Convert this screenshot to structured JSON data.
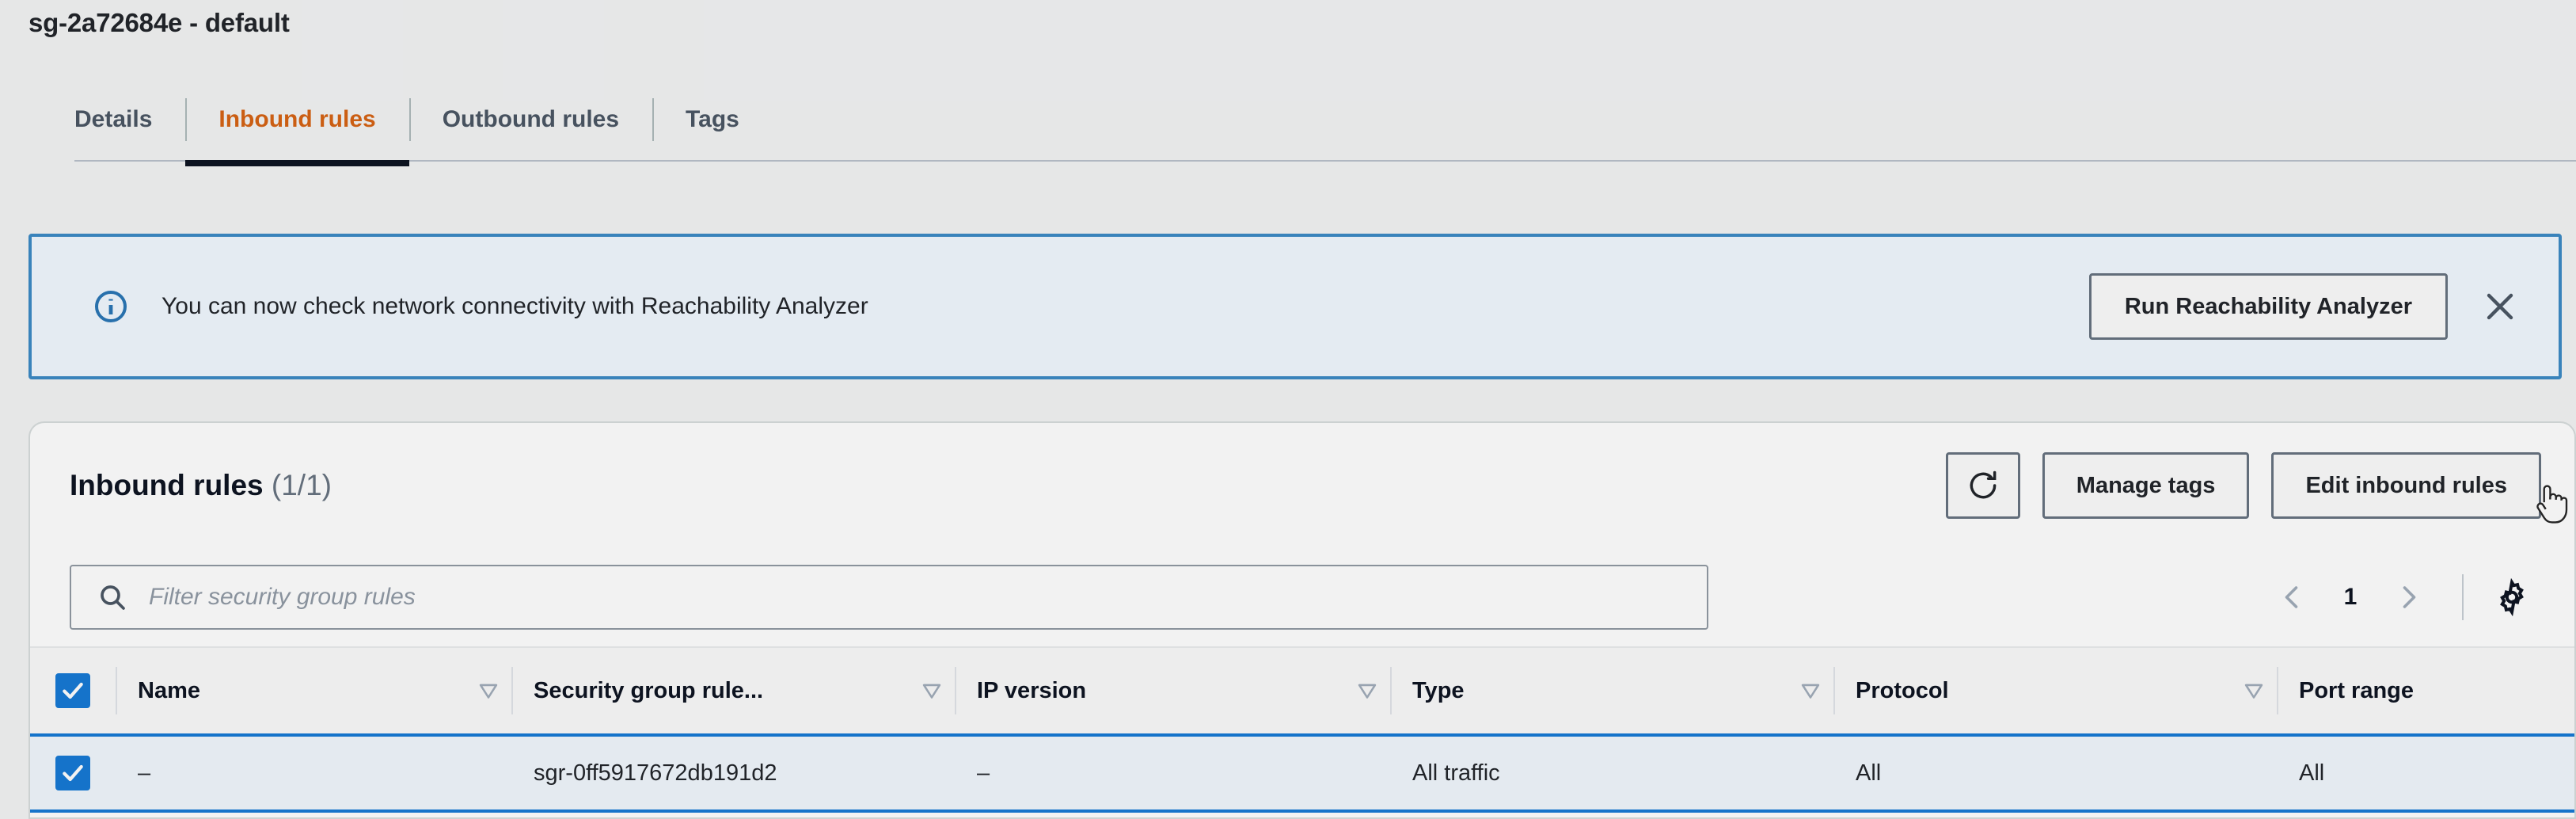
{
  "header": {
    "title": "sg-2a72684e - default"
  },
  "tabs": [
    {
      "label": "Details",
      "active": false
    },
    {
      "label": "Inbound rules",
      "active": true
    },
    {
      "label": "Outbound rules",
      "active": false
    },
    {
      "label": "Tags",
      "active": false
    }
  ],
  "flashbar": {
    "icon": "info-icon",
    "message": "You can now check network connectivity with Reachability Analyzer",
    "action_label": "Run Reachability Analyzer",
    "close_icon": "close-icon",
    "accent_color": "#3184c2",
    "background_color": "#f0f8ff"
  },
  "panel": {
    "title": "Inbound rules",
    "counter": "(1/1)",
    "refresh_icon": "refresh-icon",
    "manage_tags_label": "Manage tags",
    "edit_rules_label": "Edit inbound rules"
  },
  "filter": {
    "search_icon": "search-icon",
    "placeholder": "Filter security group rules",
    "value": ""
  },
  "pagination": {
    "prev_icon": "chevron-left-icon",
    "page": "1",
    "next_icon": "chevron-right-icon",
    "settings_icon": "gear-icon"
  },
  "table": {
    "select_all_checked": true,
    "columns": [
      {
        "label": "Name",
        "sortable": true
      },
      {
        "label": "Security group rule...",
        "sortable": true
      },
      {
        "label": "IP version",
        "sortable": true
      },
      {
        "label": "Type",
        "sortable": true
      },
      {
        "label": "Protocol",
        "sortable": true
      },
      {
        "label": "Port range",
        "sortable": false
      }
    ],
    "rows": [
      {
        "selected": true,
        "name": "–",
        "security_group_rule_id": "sgr-0ff5917672db191d2",
        "ip_version": "–",
        "type": "All traffic",
        "protocol": "All",
        "port_range": "All"
      }
    ]
  },
  "colors": {
    "accent_orange": "#d45b07",
    "accent_blue": "#0972d3",
    "page_background": "#f2f3f3",
    "selected_row": "#f0f7fd"
  },
  "cursor": {
    "type": "pointer-hand-cursor"
  }
}
